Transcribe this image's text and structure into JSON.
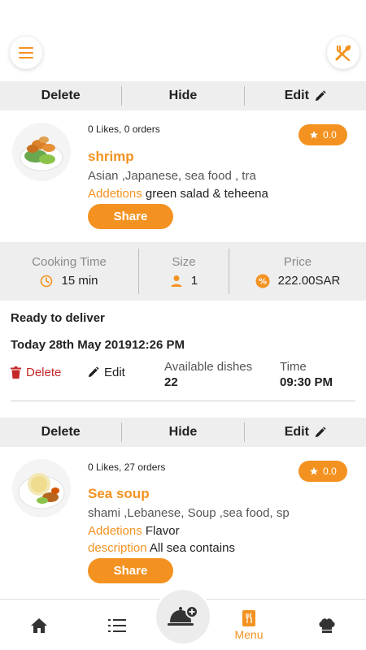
{
  "colors": {
    "accent": "#f39220",
    "danger": "#c62828",
    "bar_bg": "#eeeeee"
  },
  "header": {
    "menu_icon": "hamburger-icon",
    "right_icon": "utensils-icon"
  },
  "dishes": [
    {
      "actions": {
        "delete": "Delete",
        "hide": "Hide",
        "edit": "Edit"
      },
      "stats_line": "0 Likes, 0 orders",
      "rating": "0.0",
      "name": "shrimp",
      "cuisine": "Asian ,Japanese, sea food , tra",
      "additions_label": "Addetions",
      "additions_value": "green salad & teheena",
      "share": "Share"
    },
    {
      "actions": {
        "delete": "Delete",
        "hide": "Hide",
        "edit": "Edit"
      },
      "stats_line": "0 Likes, 27 orders",
      "rating": "0.0",
      "name": "Sea soup",
      "cuisine": "shami ,Lebanese, Soup ,sea food, sp",
      "additions_label": "Addetions",
      "additions_value": "Flavor",
      "description_label": "description",
      "description_value": "All sea contains",
      "share": "Share"
    }
  ],
  "stats": {
    "cooking_time_label": "Cooking Time",
    "cooking_time_value": "15 min",
    "size_label": "Size",
    "size_value": "1",
    "price_label": "Price",
    "price_value": "222.00SAR"
  },
  "order": {
    "status": "Ready to deliver",
    "date": "Today 28th May 201912:26 PM",
    "delete": "Delete",
    "edit": "Edit",
    "available_label": "Available dishes",
    "available_value": "22",
    "time_label": "Time",
    "time_value": "09:30 PM"
  },
  "nav": {
    "menu_label": "Menu"
  }
}
